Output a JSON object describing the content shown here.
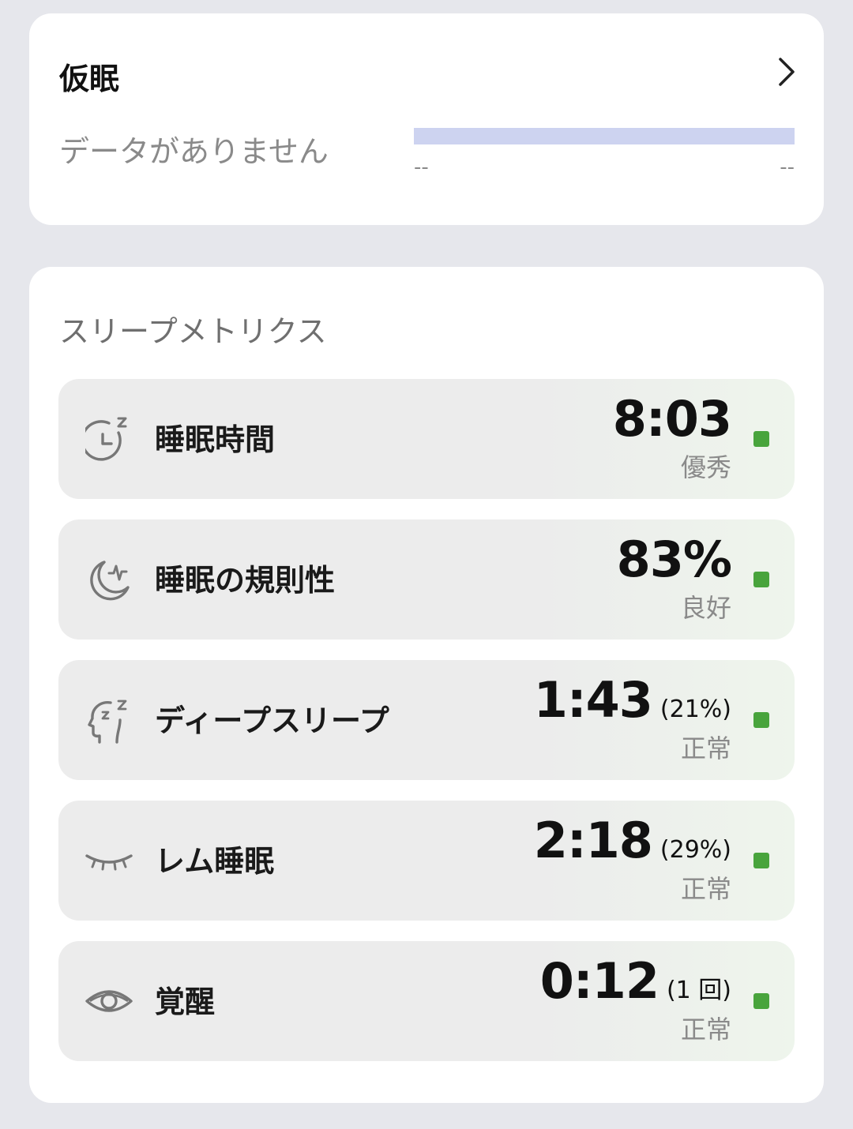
{
  "nap": {
    "title": "仮眠",
    "empty_text": "データがありません",
    "range_start": "--",
    "range_end": "--"
  },
  "metrics": {
    "title": "スリープメトリクス",
    "status_color": "#48a43c",
    "items": [
      {
        "icon": "clock-zz-icon",
        "label": "睡眠時間",
        "value": "8:03",
        "detail": "",
        "status": "優秀"
      },
      {
        "icon": "moon-wave-icon",
        "label": "睡眠の規則性",
        "value": "83%",
        "detail": "",
        "status": "良好"
      },
      {
        "icon": "head-zz-icon",
        "label": "ディープスリープ",
        "value": "1:43",
        "detail": "(21%)",
        "status": "正常"
      },
      {
        "icon": "closed-eye-icon",
        "label": "レム睡眠",
        "value": "2:18",
        "detail": "(29%)",
        "status": "正常"
      },
      {
        "icon": "open-eye-icon",
        "label": "覚醒",
        "value": "0:12",
        "detail": "(1 回)",
        "status": "正常"
      }
    ]
  }
}
